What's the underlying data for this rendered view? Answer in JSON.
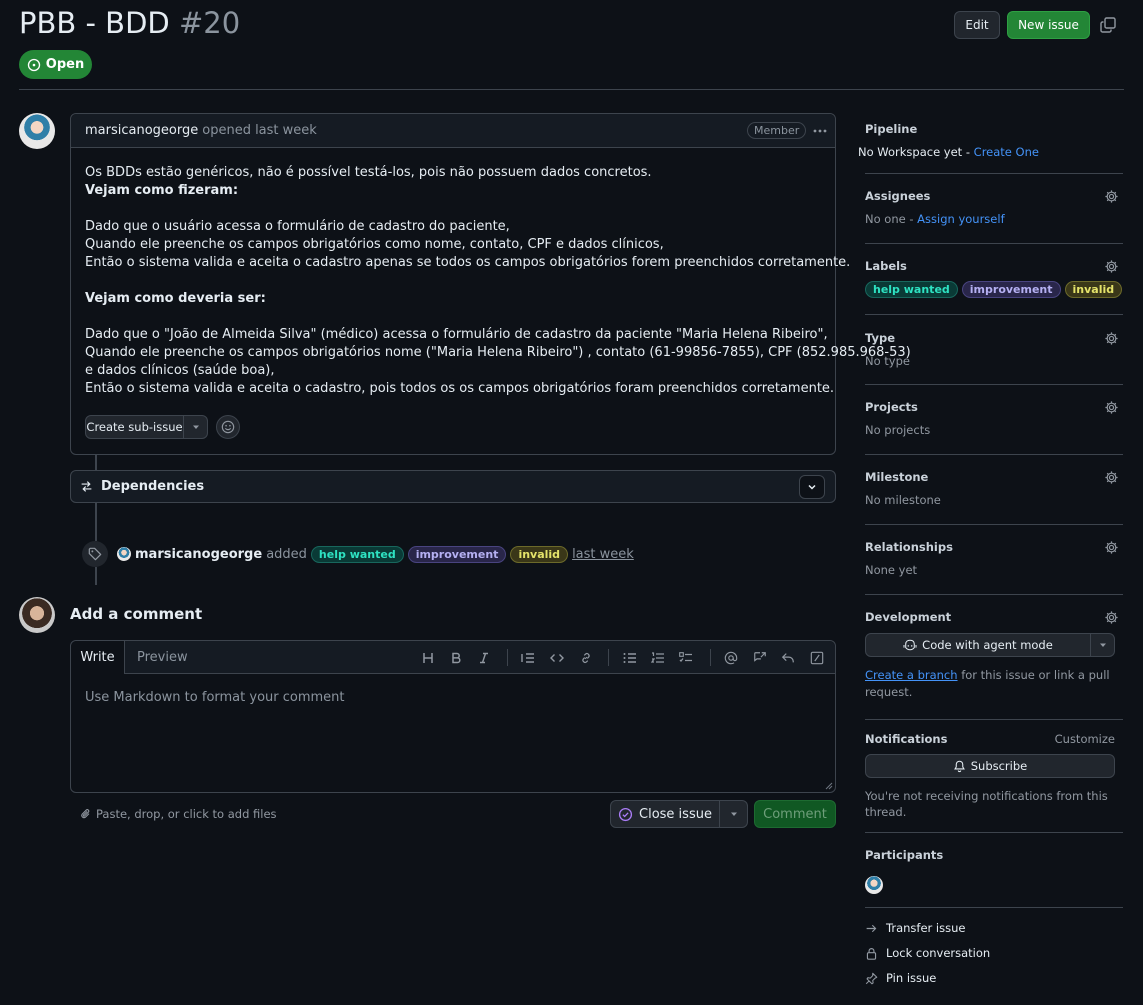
{
  "issue": {
    "title": "PBB - BDD",
    "number": "#20",
    "state": "Open"
  },
  "header": {
    "edit_label": "Edit",
    "new_issue_label": "New issue"
  },
  "comment": {
    "author": "marsicanogeorge",
    "meta": "opened last week",
    "role_badge": "Member",
    "body": [
      "Os BDDs estão genéricos, não é possível testá-los, pois não possuem dados concretos.",
      "Vejam como fizeram:",
      "Dado que o usuário acessa o formulário de cadastro do paciente,",
      "Quando ele preenche os campos obrigatórios como nome, contato, CPF e dados clínicos,",
      "Então o sistema valida e aceita o cadastro apenas se todos os campos obrigatórios forem preenchidos corretamente.",
      "Vejam como deveria ser:",
      "Dado que o \"João de Almeida Silva\" (médico) acessa o formulário de cadastro da paciente \"Maria Helena Ribeiro\",",
      "Quando ele preenche os campos obrigatórios nome (\"Maria Helena Ribeiro\") , contato (61-99856-7855), CPF (852.985.968-53)",
      "e dados clínicos (saúde boa),",
      "Então o sistema valida e aceita o cadastro, pois todos os os campos obrigatórios foram preenchidos corretamente."
    ],
    "create_sub_issue_label": "Create sub-issue"
  },
  "dependencies": {
    "label": "Dependencies"
  },
  "label_event": {
    "actor": "marsicanogeorge",
    "verb": "added",
    "labels": [
      "help wanted",
      "improvement",
      "invalid"
    ],
    "time": "last week"
  },
  "new_comment": {
    "title": "Add a comment",
    "tab_write": "Write",
    "tab_preview": "Preview",
    "placeholder": "Use Markdown to format your comment",
    "attach_label": "Paste, drop, or click to add files",
    "close_issue_label": "Close issue",
    "comment_label": "Comment"
  },
  "sidebar": {
    "pipeline": {
      "title": "Pipeline",
      "value": "No Workspace yet - ",
      "link": "Create One"
    },
    "assignees": {
      "title": "Assignees",
      "value": "No one - ",
      "link": "Assign yourself"
    },
    "labels": {
      "title": "Labels",
      "items": [
        "help wanted",
        "improvement",
        "invalid"
      ]
    },
    "type": {
      "title": "Type",
      "value": "No type"
    },
    "projects": {
      "title": "Projects",
      "value": "No projects"
    },
    "milestone": {
      "title": "Milestone",
      "value": "No milestone"
    },
    "relationships": {
      "title": "Relationships",
      "value": "None yet"
    },
    "development": {
      "title": "Development",
      "agent_label": "Code with agent mode",
      "branch_link": "Create a branch",
      "branch_text_1": " for this issue or link a pull",
      "branch_text_2": "request."
    },
    "notifications": {
      "title": "Notifications",
      "customize": "Customize",
      "subscribe_label": "Subscribe",
      "note_1": "You're not receiving notifications from this",
      "note_2": "thread."
    },
    "participants": {
      "title": "Participants"
    },
    "actions": {
      "transfer": "Transfer issue",
      "lock": "Lock conversation",
      "pin": "Pin issue"
    }
  },
  "colors": {
    "background": "#0d1117",
    "border": "#3d444d",
    "open_green": "#238636",
    "link_blue": "#4493f8",
    "label_help_wanted": "#2ee2c2",
    "label_improvement": "#b5b0f2",
    "label_invalid": "#e4e36a"
  },
  "icons": [
    "issue-opened-icon",
    "copy-icon",
    "kebab-icon",
    "triangle-down-icon",
    "smiley-icon",
    "dependencies-icon",
    "chevron-down-icon",
    "tag-icon",
    "heading-icon",
    "bold-icon",
    "italic-icon",
    "quote-icon",
    "code-icon",
    "link-icon",
    "unordered-list-icon",
    "ordered-list-icon",
    "tasklist-icon",
    "mention-icon",
    "cross-reference-icon",
    "reply-icon",
    "slash-command-icon",
    "paperclip-icon",
    "issue-closed-icon",
    "gear-icon",
    "copilot-icon",
    "bell-icon",
    "arrow-right-icon",
    "lock-icon",
    "pin-icon"
  ]
}
